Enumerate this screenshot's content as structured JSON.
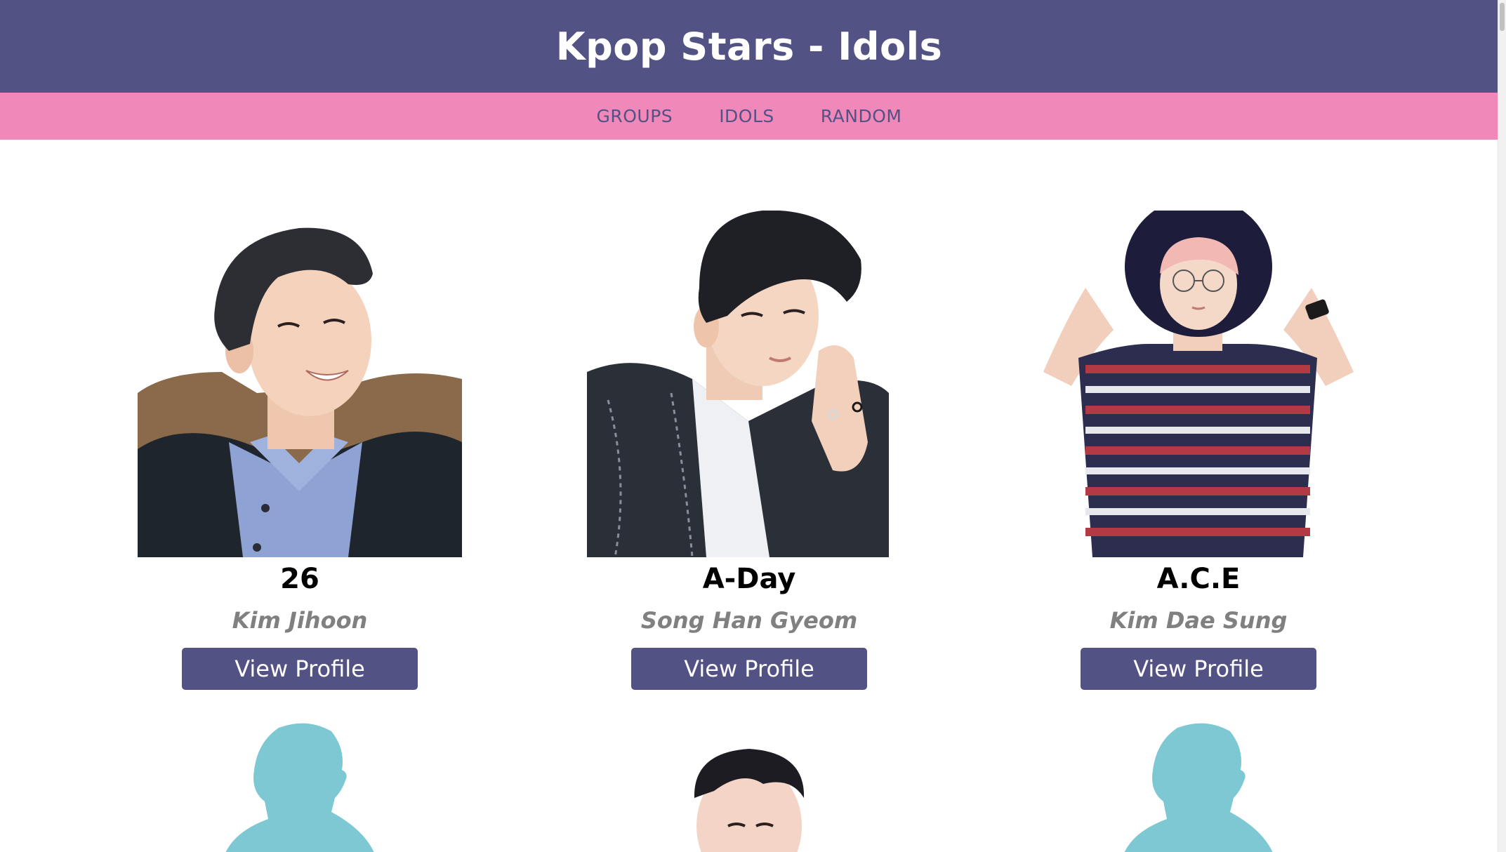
{
  "header": {
    "title": "Kpop Stars - Idols"
  },
  "nav": {
    "items": [
      "GROUPS",
      "IDOLS",
      "RANDOM"
    ]
  },
  "idols": [
    {
      "group": "26",
      "name": "Kim Jihoon",
      "button": "View Profile"
    },
    {
      "group": "A-Day",
      "name": "Song Han Gyeom",
      "button": "View Profile"
    },
    {
      "group": "A.C.E",
      "name": "Kim Dae Sung",
      "button": "View Profile"
    }
  ],
  "colors": {
    "header_bg": "#535285",
    "nav_bg": "#f088b9",
    "button_bg": "#535285",
    "idol_name": "#808080",
    "silhouette": "#7ec8d4"
  }
}
